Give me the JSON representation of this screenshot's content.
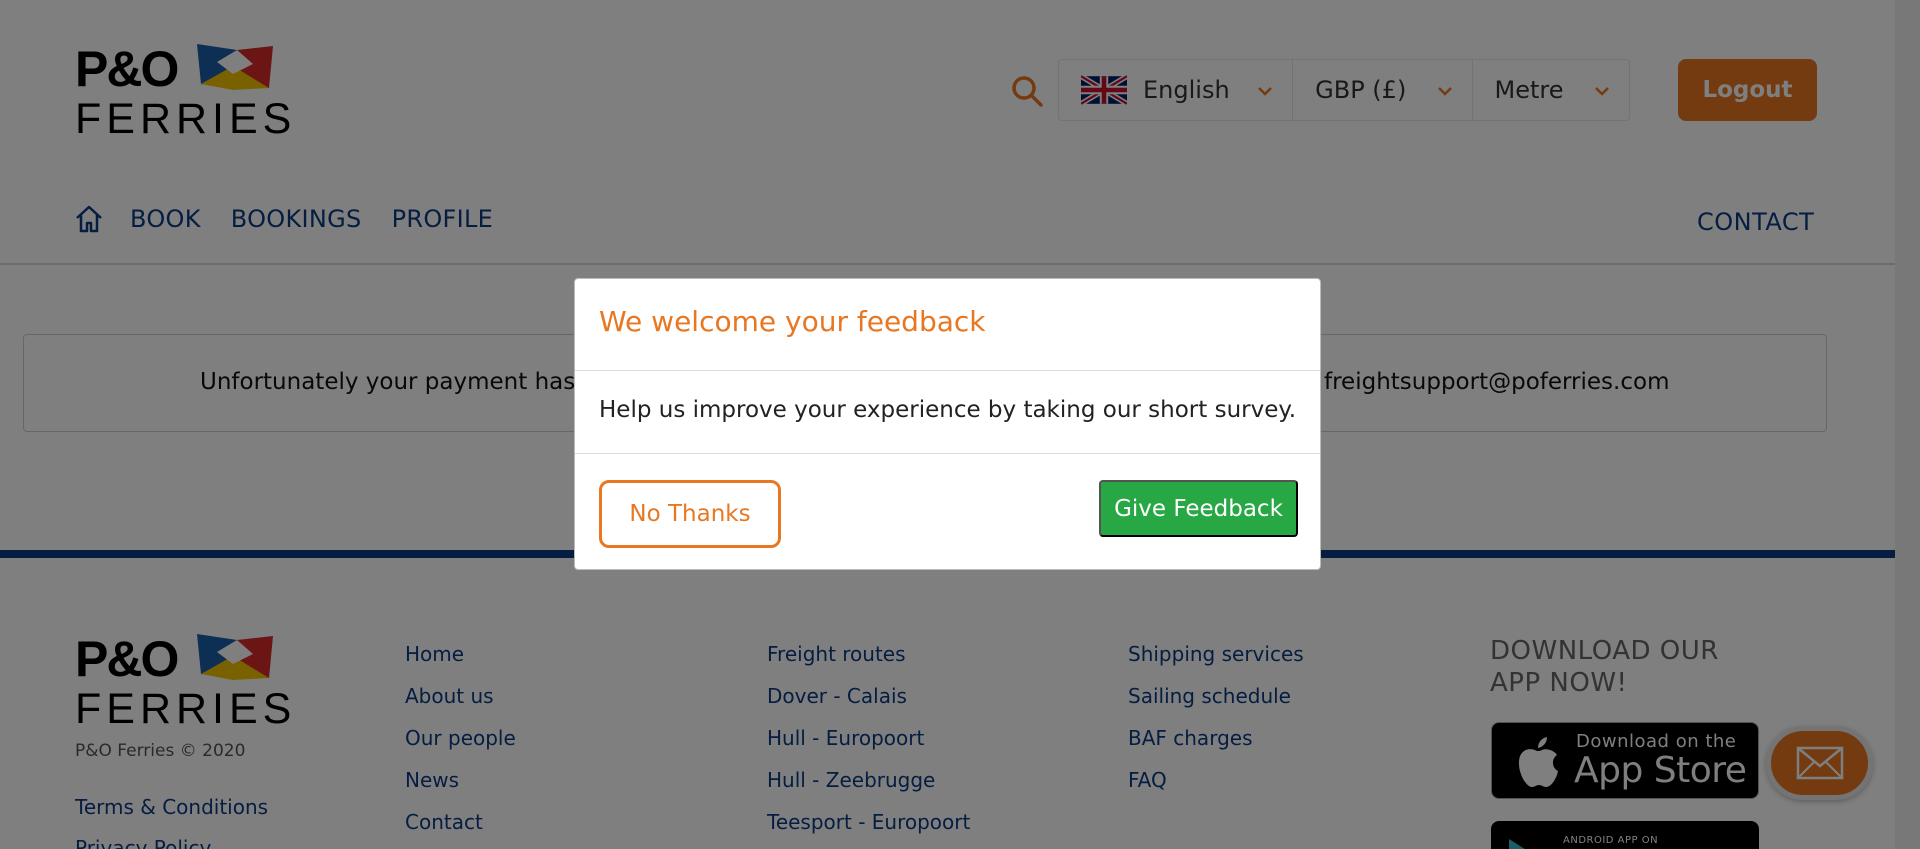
{
  "header": {
    "logo": {
      "wordmark_top": "P&O",
      "wordmark_bottom": "FERRIES"
    },
    "search_icon": "search-icon",
    "language": {
      "selected": "English",
      "icon": "uk-flag-icon"
    },
    "currency": {
      "selected": "GBP (£)"
    },
    "unit": {
      "selected": "Metre"
    },
    "logout_label": "Logout"
  },
  "nav": {
    "home_icon": "home-icon",
    "items": [
      {
        "label": "BOOK"
      },
      {
        "label": "BOOKINGS"
      },
      {
        "label": "PROFILE"
      }
    ],
    "contact_label": "CONTACT"
  },
  "alert": {
    "text_left": "Unfortunately your payment has b",
    "text_right": "freightsupport@poferries.com"
  },
  "footer": {
    "logo": {
      "wordmark_top": "P&O",
      "wordmark_bottom": "FERRIES"
    },
    "copyright": "P&O Ferries © 2020",
    "terms": "Terms & Conditions",
    "privacy": "Privacy Policy",
    "col1": [
      "Home",
      "About us",
      "Our people",
      "News",
      "Contact"
    ],
    "col2": [
      "Freight routes",
      "Dover - Calais",
      "Hull - Europoort",
      "Hull - Zeebrugge",
      "Teesport - Europoort"
    ],
    "col3": [
      "Shipping services",
      "Sailing schedule",
      "BAF charges",
      "FAQ"
    ],
    "app_title": "DOWNLOAD OUR APP NOW!",
    "appstore_small": "Download on the",
    "appstore_big": "App Store",
    "playstore_small": "ANDROID APP ON",
    "mail_icon": "mail-icon"
  },
  "modal": {
    "title": "We welcome your feedback",
    "body": "Help us improve your experience by taking our short survey.",
    "no_thanks_label": "No Thanks",
    "give_feedback_label": "Give Feedback"
  },
  "colors": {
    "accent_orange": "#e87722",
    "brand_navy": "#0c3b84",
    "success_green": "#28a745"
  }
}
